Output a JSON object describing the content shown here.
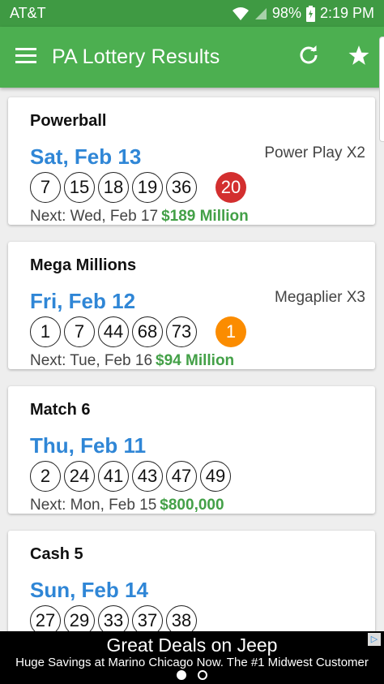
{
  "status_bar": {
    "carrier": "AT&T",
    "battery": "98%",
    "time": "2:19 PM"
  },
  "app_bar": {
    "title": "PA Lottery Results",
    "menu_icon": "hamburger-menu-icon",
    "refresh_icon": "refresh-icon",
    "favorite_icon": "star-icon"
  },
  "colors": {
    "primary": "#4caf50",
    "primary_dark": "#3f9a43",
    "date_blue": "#2f86d6",
    "jackpot_green": "#43a047",
    "powerball_red": "#d32f2f",
    "megaball_orange": "#fb8c00"
  },
  "cards": [
    {
      "title": "Powerball",
      "date": "Sat, Feb 13",
      "extra": "Power Play X2",
      "balls": [
        "7",
        "15",
        "18",
        "19",
        "36"
      ],
      "bonus": "20",
      "bonus_color": "#d32f2f",
      "next": "Next: Wed, Feb 17",
      "jackpot": "$189 Million"
    },
    {
      "title": "Mega Millions",
      "date": "Fri, Feb 12",
      "extra": "Megaplier X3",
      "balls": [
        "1",
        "7",
        "44",
        "68",
        "73"
      ],
      "bonus": "1",
      "bonus_color": "#fb8c00",
      "next": "Next: Tue, Feb 16",
      "jackpot": "$94 Million"
    },
    {
      "title": "Match 6",
      "date": "Thu, Feb 11",
      "extra": "",
      "balls": [
        "2",
        "24",
        "41",
        "43",
        "47",
        "49"
      ],
      "bonus": "",
      "next": "Next: Mon, Feb 15",
      "jackpot": "$800,000"
    },
    {
      "title": "Cash 5",
      "date": "Sun, Feb 14",
      "extra": "",
      "balls": [
        "27",
        "29",
        "33",
        "37",
        "38"
      ],
      "bonus": "",
      "next": "",
      "jackpot": ""
    }
  ],
  "ad": {
    "title": "Great Deals on Jeep",
    "body": "Huge Savings at Marino Chicago Now. The #1 Midwest Customer",
    "choice_icon": "ad-choices-icon",
    "dots": 2,
    "active_dot": 0
  }
}
